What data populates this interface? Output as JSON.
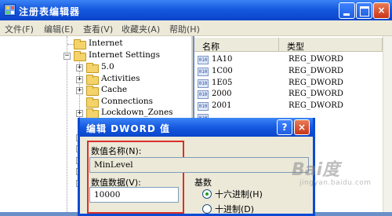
{
  "window": {
    "title": "注册表编辑器",
    "controls": {
      "minimize": "",
      "maximize": "",
      "close": "×"
    }
  },
  "menu": [
    "文件(F)",
    "编辑(E)",
    "查看(V)",
    "收藏夹(A)",
    "帮助(H)"
  ],
  "tree": {
    "nodes": [
      {
        "label": "Internet",
        "expander": ""
      },
      {
        "label": "Internet Settings",
        "expander": "−"
      },
      {
        "label": "5.0",
        "expander": "+"
      },
      {
        "label": "Activities",
        "expander": "+"
      },
      {
        "label": "Cache",
        "expander": "+"
      },
      {
        "label": "Connections",
        "expander": ""
      },
      {
        "label": "Lockdown_Zones",
        "expander": "+"
      }
    ]
  },
  "list": {
    "columns": {
      "name": "名称",
      "type": "类型"
    },
    "rows": [
      {
        "name": "1A10",
        "type": "REG_DWORD"
      },
      {
        "name": "1C00",
        "type": "REG_DWORD"
      },
      {
        "name": "1E05",
        "type": "REG_DWORD"
      },
      {
        "name": "2000",
        "type": "REG_DWORD"
      },
      {
        "name": "2001",
        "type": "REG_DWORD"
      }
    ],
    "icon_text": "010"
  },
  "dialog": {
    "title": "编辑 DWORD 值",
    "help_label": "?",
    "close_label": "×",
    "value_name_label": "数值名称(N):",
    "value_name": "MinLevel",
    "value_data_label": "数值数据(V):",
    "value_data": "10000",
    "base_label": "基数",
    "base_options": [
      {
        "label": "十六进制(H)",
        "selected": true
      },
      {
        "label": "十进制(D)",
        "selected": false
      }
    ]
  },
  "watermark": {
    "main": "Bai度",
    "sub": "jingyan.baidu.com"
  },
  "colors": {
    "titlebar": "#1659e0",
    "highlight_box": "#d8302a",
    "dialog_bg": "#ece9d8"
  }
}
